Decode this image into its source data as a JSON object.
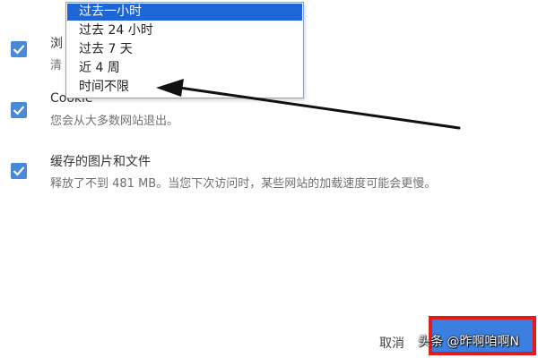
{
  "time_range_dropdown": {
    "options": [
      "过去一小时",
      "过去 24 小时",
      "过去 7 天",
      "近 4 周",
      "时间不限"
    ],
    "selected_index": 0
  },
  "items": [
    {
      "title": "浏",
      "description": "清",
      "checked": true
    },
    {
      "title": "Cookie",
      "description": "您会从大多数网站退出。",
      "checked": true
    },
    {
      "title": "缓存的图片和文件",
      "description": "释放了不到 481 MB。当您下次访问时，某些网站的加载速度可能会更慢。",
      "checked": true
    }
  ],
  "footer": {
    "cancel_label": "取消",
    "clear_label": "",
    "clear_button_highlight_color": "#e51b1b"
  },
  "watermark": "头条 @昨啊咱啊N",
  "colors": {
    "checkbox": "#4a88d8",
    "selected_option": "#1e66d8",
    "primary_button": "#3b7fe0"
  }
}
